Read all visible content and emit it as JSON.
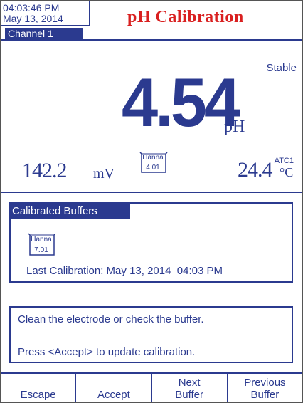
{
  "header": {
    "time": "04:03:46 PM",
    "date": "May 13, 2014",
    "title": "pH Calibration"
  },
  "channel": {
    "label": "Channel 1"
  },
  "reading": {
    "stability": "Stable",
    "value": "4.54",
    "unit": "pH",
    "mv_value": "142.2",
    "mv_unit": "mV",
    "current_buffer": {
      "brand": "Hanna",
      "value": "4.01"
    },
    "atc_label": "ATC1",
    "temp_value": "24.4",
    "temp_unit": "°C"
  },
  "calibrated_buffers": {
    "title": "Calibrated Buffers",
    "buffer": {
      "brand": "Hanna",
      "value": "7.01"
    },
    "last_calibration": "Last Calibration: May 13, 2014  04:03 PM"
  },
  "message": {
    "line1": "Clean the electrode or check the buffer.",
    "line2": "Press <Accept> to update calibration."
  },
  "softkeys": [
    {
      "label": "Escape"
    },
    {
      "label": "Accept"
    },
    {
      "label": "Next Buffer"
    },
    {
      "label": "Previous Buffer"
    }
  ],
  "colors": {
    "primary": "#2b3a8f",
    "title": "#d92020",
    "background": "#ffffff"
  }
}
